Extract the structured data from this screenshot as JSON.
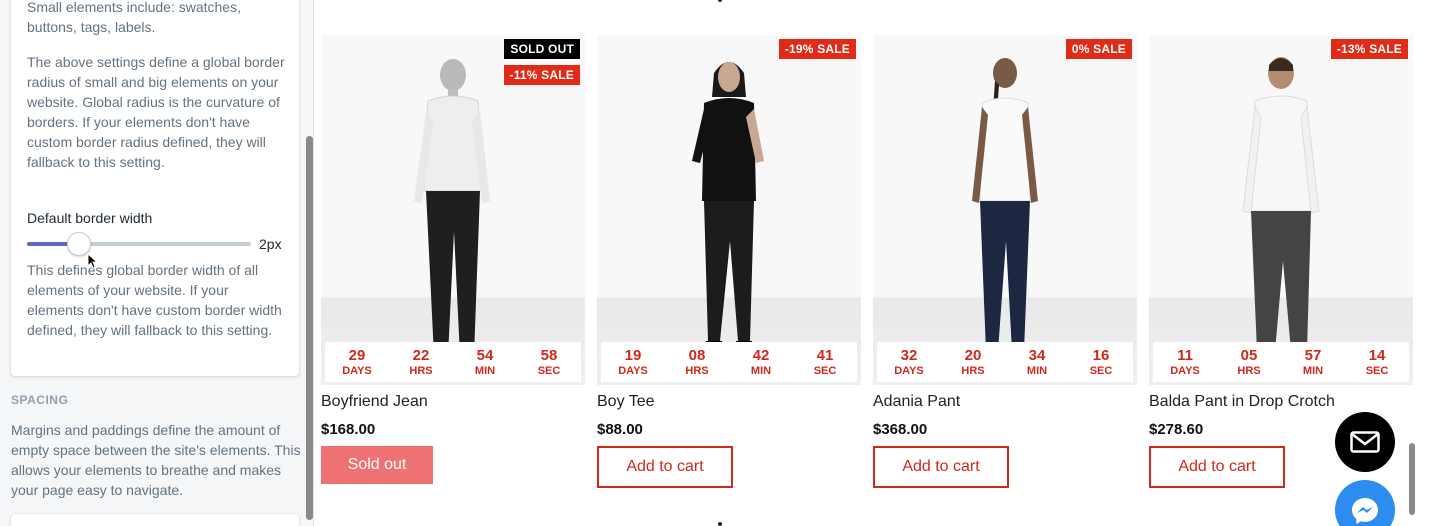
{
  "panel": {
    "card_text_top": "Small elements include: swatches, buttons, tags, labels.",
    "card_text_radius": "The above settings define a global border radius of small and big elements on your website. Global radius is the curvature of borders. If your elements don't have custom border radius defined, they will fallback to this setting.",
    "border_width_label": "Default border width",
    "border_width_value": "2px",
    "border_width_level": 0.2,
    "card_text_width": "This defines global border width of all elements of your website. If your elements don't have custom border width defined, they will fallback to this setting.",
    "spacing_title": "SPACING",
    "spacing_text": "Margins and paddings define the amount of empty space between the site's elements. This allows your elements to breathe and makes your page easy to navigate."
  },
  "products": [
    {
      "name": "Boyfriend Jean",
      "price": "$168.00",
      "badges": [
        "SOLD OUT",
        "-11% SALE"
      ],
      "countdown": [
        {
          "value": "29",
          "unit": "DAYS"
        },
        {
          "value": "22",
          "unit": "HRS"
        },
        {
          "value": "54",
          "unit": "MIN"
        },
        {
          "value": "58",
          "unit": "SEC"
        }
      ],
      "button": "Sold out"
    },
    {
      "name": "Boy Tee",
      "price": "$88.00",
      "badges": [
        "-19% SALE"
      ],
      "countdown": [
        {
          "value": "19",
          "unit": "DAYS"
        },
        {
          "value": "08",
          "unit": "HRS"
        },
        {
          "value": "42",
          "unit": "MIN"
        },
        {
          "value": "41",
          "unit": "SEC"
        }
      ],
      "button": "Add to cart"
    },
    {
      "name": "Adania Pant",
      "price": "$368.00",
      "badges": [
        "0% SALE"
      ],
      "countdown": [
        {
          "value": "32",
          "unit": "DAYS"
        },
        {
          "value": "20",
          "unit": "HRS"
        },
        {
          "value": "34",
          "unit": "MIN"
        },
        {
          "value": "16",
          "unit": "SEC"
        }
      ],
      "button": "Add to cart"
    },
    {
      "name": "Balda Pant in Drop Crotch",
      "price": "$278.60",
      "badges": [
        "-13% SALE"
      ],
      "countdown": [
        {
          "value": "11",
          "unit": "DAYS"
        },
        {
          "value": "05",
          "unit": "HRS"
        },
        {
          "value": "57",
          "unit": "MIN"
        },
        {
          "value": "14",
          "unit": "SEC"
        }
      ],
      "button": "Add to cart"
    }
  ],
  "colors": {
    "sale_badge": "#e02b18",
    "sold_badge": "#000000",
    "countdown_text": "#d0281a",
    "add_to_cart": "#d0281a",
    "sold_out_button": "#ee7272",
    "slider_fill": "#5c6ac4"
  },
  "icons": {
    "mail": "mail-icon",
    "messenger": "messenger-icon",
    "cursor": "pointer-cursor-icon"
  }
}
